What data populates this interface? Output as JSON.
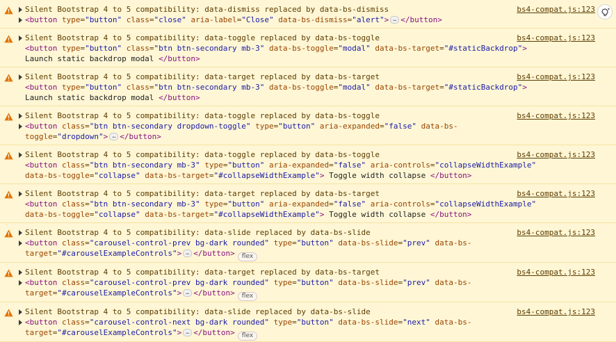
{
  "source_label": "bs4-compat.js:123",
  "messages": [
    {
      "text": "Silent Bootstrap 4 to 5 compatibility: data-dismiss replaced by data-bs-dismiss",
      "html": "<span class=\"tag\">&lt;button</span> <span class=\"attr-n\">type</span>=<span class=\"attr-v\">\"button\"</span> <span class=\"attr-n\">class</span>=<span class=\"attr-v\">\"close\"</span> <span class=\"attr-n\">aria-label</span>=<span class=\"attr-v\">\"Close\"</span> <span class=\"attr-n\">data-bs-dismiss</span>=<span class=\"attr-v\">\"alert\"</span><span class=\"tag\">&gt;</span><span class=\"ellipsis\">…</span><span class=\"tag\">&lt;/button&gt;</span>",
      "expandable": true,
      "flex": false
    },
    {
      "text": "Silent Bootstrap 4 to 5 compatibility: data-toggle replaced by data-bs-toggle",
      "html": "<span class=\"tag\">&lt;button</span> <span class=\"attr-n\">type</span>=<span class=\"attr-v\">\"button\"</span> <span class=\"attr-n\">class</span>=<span class=\"attr-v\">\"btn btn-secondary mb-3\"</span> <span class=\"attr-n\">data-bs-toggle</span>=<span class=\"attr-v\">\"modal\"</span> <span class=\"attr-n\">data-bs-target</span>=<span class=\"attr-v\">\"#staticBackdrop\"</span><span class=\"tag\">&gt;</span><span class=\"inner\"> Launch static backdrop modal </span><span class=\"tag\">&lt;/button&gt;</span>",
      "expandable": false,
      "flex": false
    },
    {
      "text": "Silent Bootstrap 4 to 5 compatibility: data-target replaced by data-bs-target",
      "html": "<span class=\"tag\">&lt;button</span> <span class=\"attr-n\">type</span>=<span class=\"attr-v\">\"button\"</span> <span class=\"attr-n\">class</span>=<span class=\"attr-v\">\"btn btn-secondary mb-3\"</span> <span class=\"attr-n\">data-bs-toggle</span>=<span class=\"attr-v\">\"modal\"</span> <span class=\"attr-n\">data-bs-target</span>=<span class=\"attr-v\">\"#staticBackdrop\"</span><span class=\"tag\">&gt;</span><span class=\"inner\"> Launch static backdrop modal </span><span class=\"tag\">&lt;/button&gt;</span>",
      "expandable": false,
      "flex": false
    },
    {
      "text": "Silent Bootstrap 4 to 5 compatibility: data-toggle replaced by data-bs-toggle",
      "html": "<span class=\"tag\">&lt;button</span> <span class=\"attr-n\">class</span>=<span class=\"attr-v\">\"btn btn-secondary dropdown-toggle\"</span> <span class=\"attr-n\">type</span>=<span class=\"attr-v\">\"button\"</span> <span class=\"attr-n\">aria-expanded</span>=<span class=\"attr-v\">\"false\"</span> <span class=\"attr-n\">data-bs-toggle</span>=<span class=\"attr-v\">\"dropdown\"</span><span class=\"tag\">&gt;</span><span class=\"ellipsis\">…</span><span class=\"tag\">&lt;/button&gt;</span>",
      "expandable": true,
      "flex": false
    },
    {
      "text": "Silent Bootstrap 4 to 5 compatibility: data-toggle replaced by data-bs-toggle",
      "html": "<span class=\"tag\">&lt;button</span> <span class=\"attr-n\">class</span>=<span class=\"attr-v\">\"btn btn-secondary mb-3\"</span> <span class=\"attr-n\">type</span>=<span class=\"attr-v\">\"button\"</span> <span class=\"attr-n\">aria-expanded</span>=<span class=\"attr-v\">\"false\"</span> <span class=\"attr-n\">aria-controls</span>=<span class=\"attr-v\">\"collapseWidthExample\"</span> <span class=\"attr-n\">data-bs-toggle</span>=<span class=\"attr-v\">\"collapse\"</span> <span class=\"attr-n\">data-bs-target</span>=<span class=\"attr-v\">\"#collapseWidthExample\"</span><span class=\"tag\">&gt;</span><span class=\"inner\"> Toggle width collapse </span><span class=\"tag\">&lt;/button&gt;</span>",
      "expandable": false,
      "flex": false
    },
    {
      "text": "Silent Bootstrap 4 to 5 compatibility: data-target replaced by data-bs-target",
      "html": "<span class=\"tag\">&lt;button</span> <span class=\"attr-n\">class</span>=<span class=\"attr-v\">\"btn btn-secondary mb-3\"</span> <span class=\"attr-n\">type</span>=<span class=\"attr-v\">\"button\"</span> <span class=\"attr-n\">aria-expanded</span>=<span class=\"attr-v\">\"false\"</span> <span class=\"attr-n\">aria-controls</span>=<span class=\"attr-v\">\"collapseWidthExample\"</span> <span class=\"attr-n\">data-bs-toggle</span>=<span class=\"attr-v\">\"collapse\"</span> <span class=\"attr-n\">data-bs-target</span>=<span class=\"attr-v\">\"#collapseWidthExample\"</span><span class=\"tag\">&gt;</span><span class=\"inner\"> Toggle width collapse </span><span class=\"tag\">&lt;/button&gt;</span>",
      "expandable": false,
      "flex": false
    },
    {
      "text": "Silent Bootstrap 4 to 5 compatibility: data-slide replaced by data-bs-slide",
      "html": "<span class=\"tag\">&lt;button</span> <span class=\"attr-n\">class</span>=<span class=\"attr-v\">\"carousel-control-prev bg-dark rounded\"</span> <span class=\"attr-n\">type</span>=<span class=\"attr-v\">\"button\"</span> <span class=\"attr-n\">data-bs-slide</span>=<span class=\"attr-v\">\"prev\"</span> <span class=\"attr-n\">data-bs-target</span>=<span class=\"attr-v\">\"#carouselExampleControls\"</span><span class=\"tag\">&gt;</span><span class=\"ellipsis\">…</span><span class=\"tag\">&lt;/button&gt;</span>",
      "expandable": true,
      "flex": true
    },
    {
      "text": "Silent Bootstrap 4 to 5 compatibility: data-target replaced by data-bs-target",
      "html": "<span class=\"tag\">&lt;button</span> <span class=\"attr-n\">class</span>=<span class=\"attr-v\">\"carousel-control-prev bg-dark rounded\"</span> <span class=\"attr-n\">type</span>=<span class=\"attr-v\">\"button\"</span> <span class=\"attr-n\">data-bs-slide</span>=<span class=\"attr-v\">\"prev\"</span> <span class=\"attr-n\">data-bs-target</span>=<span class=\"attr-v\">\"#carouselExampleControls\"</span><span class=\"tag\">&gt;</span><span class=\"ellipsis\">…</span><span class=\"tag\">&lt;/button&gt;</span>",
      "expandable": true,
      "flex": true
    },
    {
      "text": "Silent Bootstrap 4 to 5 compatibility: data-slide replaced by data-bs-slide",
      "html": "<span class=\"tag\">&lt;button</span> <span class=\"attr-n\">class</span>=<span class=\"attr-v\">\"carousel-control-next bg-dark rounded\"</span> <span class=\"attr-n\">type</span>=<span class=\"attr-v\">\"button\"</span> <span class=\"attr-n\">data-bs-slide</span>=<span class=\"attr-v\">\"next\"</span> <span class=\"attr-n\">data-bs-target</span>=<span class=\"attr-v\">\"#carouselExampleControls\"</span><span class=\"tag\">&gt;</span><span class=\"ellipsis\">…</span><span class=\"tag\">&lt;/button&gt;</span>",
      "expandable": true,
      "flex": true
    }
  ],
  "flex_label": "flex",
  "colors": {
    "warning_bg": "#fef6d5",
    "warning_border": "#f5e3a3",
    "warning_icon": "#e37400",
    "tag": "#881280",
    "attr_name": "#994500",
    "attr_value": "#1a1aa6"
  },
  "icons": {
    "warning": "warning-triangle-icon",
    "expand": "expand-triangle-icon",
    "assist": "lightbulb-sparkle-icon"
  }
}
